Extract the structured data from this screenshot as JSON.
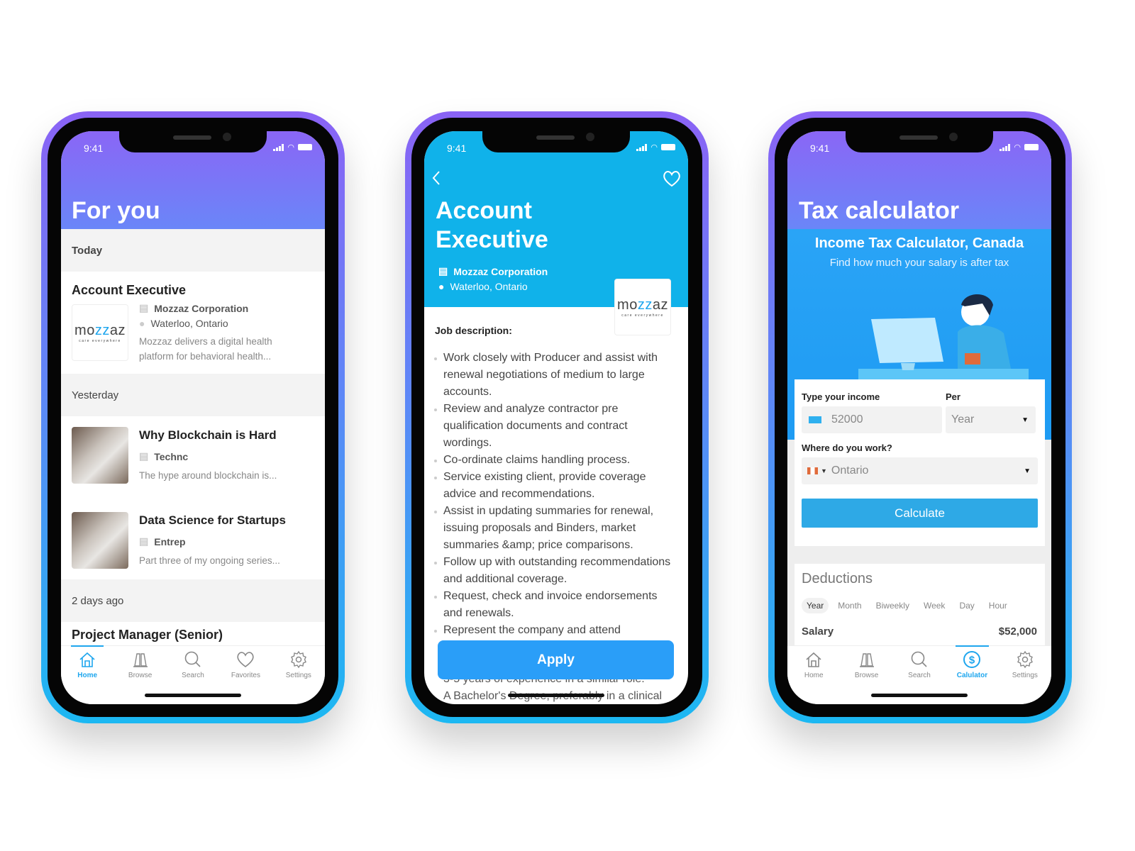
{
  "status_time": "9:41",
  "colors": {
    "accent": "#1ea6ee",
    "apply": "#2a9ef8",
    "calculate": "#2ea9e6",
    "header_cyan": "#10b2ea"
  },
  "feed": {
    "title": "For you",
    "sections": {
      "today": "Today",
      "yesterday": "Yesterday",
      "two_days": "2 days ago"
    },
    "job": {
      "title": "Account Executive",
      "company": "Mozzaz Corporation",
      "location": "Waterloo, Ontario",
      "description": "Mozzaz delivers a digital health platform for behavioral health...",
      "logo_word": "mozzaz",
      "logo_tag": "care everywhere"
    },
    "articles": [
      {
        "title": "Why Blockchain is Hard",
        "category": "Technc",
        "excerpt": "The hype around blockchain is..."
      },
      {
        "title": "Data Science for Startups",
        "category": "Entrep",
        "excerpt": "Part three of my ongoing series..."
      }
    ],
    "next_title": "Project Manager (Senior)",
    "tabs": [
      {
        "label": "Home",
        "icon": "home-icon",
        "active": true
      },
      {
        "label": "Browse",
        "icon": "binoculars-icon"
      },
      {
        "label": "Search",
        "icon": "search-icon"
      },
      {
        "label": "Favorites",
        "icon": "heart-icon"
      },
      {
        "label": "Settings",
        "icon": "gear-icon"
      }
    ]
  },
  "detail": {
    "title_line1": "Account",
    "title_line2": "Executive",
    "company": "Mozzaz Corporation",
    "location": "Waterloo, Ontario",
    "logo_word": "mozzaz",
    "logo_tag": "care everywhere",
    "job_description_label": "Job description:",
    "bullets": [
      "Work closely with Producer and assist with renewal negotiations of medium to large accounts.",
      "Review and analyze contractor pre qualification documents and contract wordings.",
      "Co-ordinate claims handling process.",
      "Service existing client, provide coverage advice and recommendations.",
      "Assist in updating summaries for renewal, issuing proposals and Binders, market summaries &amp; price comparisons.",
      "Follow up with outstanding recommendations and additional coverage.",
      "Request, check and invoice endorsements and renewals.",
      "Represent the company and attend"
    ],
    "below": [
      "3-5 years of experience in a similar role.",
      "A Bachelor's Degree, preferably in a clinical"
    ],
    "apply_label": "Apply"
  },
  "calc": {
    "title": "Tax calculator",
    "subtitle": "Income Tax Calculator, Canada",
    "tagline": "Find how much your salary is after tax",
    "income_label": "Type your income",
    "income_value": "52000",
    "per_label": "Per",
    "per_value": "Year",
    "work_label": "Where do you work?",
    "work_value": "Ontario",
    "calculate_label": "Calculate",
    "deductions_title": "Deductions",
    "periods": [
      "Year",
      "Month",
      "Biweekly",
      "Week",
      "Day",
      "Hour"
    ],
    "selected_period": "Year",
    "salary_label": "Salary",
    "salary_value": "$52,000",
    "tabs": [
      {
        "label": "Home",
        "icon": "home-icon"
      },
      {
        "label": "Browse",
        "icon": "binoculars-icon"
      },
      {
        "label": "Search",
        "icon": "search-icon"
      },
      {
        "label": "Calulator",
        "icon": "dollar-circle-icon",
        "active": true
      },
      {
        "label": "Settings",
        "icon": "gear-icon"
      }
    ]
  }
}
